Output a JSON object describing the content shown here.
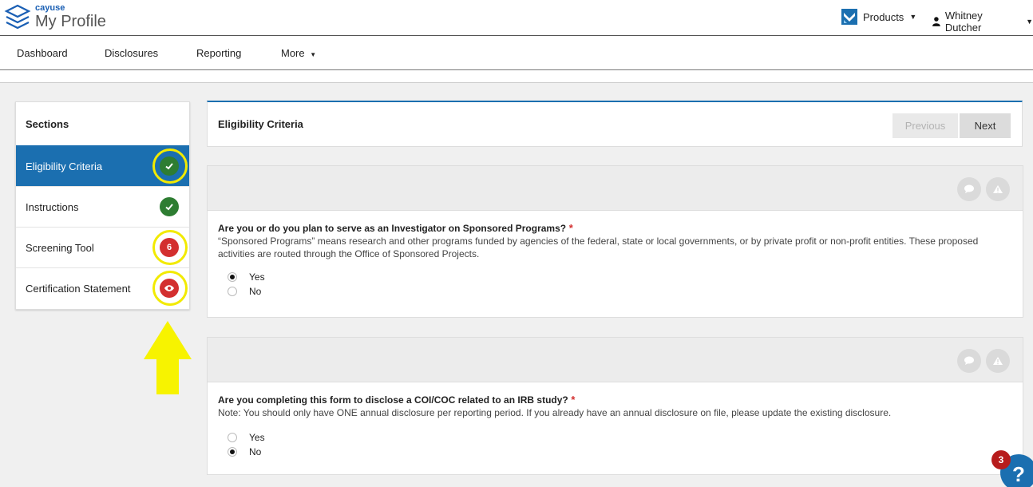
{
  "app": {
    "brand_small": "cayuse",
    "brand_large": "My Profile"
  },
  "topbar": {
    "products_label": "Products",
    "user_name": "Whitney Dutcher"
  },
  "nav": {
    "items": [
      "Dashboard",
      "Disclosures",
      "Reporting",
      "More"
    ]
  },
  "sidebar": {
    "title": "Sections",
    "items": [
      {
        "label": "Eligibility Criteria",
        "status": "check",
        "active": true
      },
      {
        "label": "Instructions",
        "status": "check"
      },
      {
        "label": "Screening Tool",
        "status": "6"
      },
      {
        "label": "Certification Statement",
        "status": "eye"
      }
    ]
  },
  "header": {
    "title": "Eligibility Criteria",
    "previous_label": "Previous",
    "next_label": "Next"
  },
  "questions": [
    {
      "text": "Are you or do you plan to serve as an Investigator on Sponsored Programs?",
      "required": "*",
      "help": "“Sponsored Programs” means research and other programs funded by agencies of the federal, state or local governments, or by private profit or non-profit entities. These proposed activities are routed through the Office of Sponsored Projects.",
      "options": [
        "Yes",
        "No"
      ],
      "selected": "Yes"
    },
    {
      "text": "Are you completing this form to disclose a COI/COC related to an IRB study?",
      "required": "*",
      "help": "Note: You should only have ONE annual disclosure per reporting period.  If you already have an annual disclosure on file, please update the existing disclosure.",
      "options": [
        "Yes",
        "No"
      ],
      "selected": "No"
    }
  ],
  "help_widget": {
    "count": "3",
    "symbol": "?"
  },
  "colors": {
    "primary": "#1b6fb0",
    "success": "#2e7d32",
    "danger": "#d32f2f",
    "highlight": "#f2ea00"
  },
  "icons": [
    "cayuse-logo-icon",
    "products-icon",
    "user-icon",
    "check-icon",
    "eye-icon",
    "comment-icon",
    "warning-icon",
    "up-arrow-annotation-icon",
    "help-icon"
  ]
}
